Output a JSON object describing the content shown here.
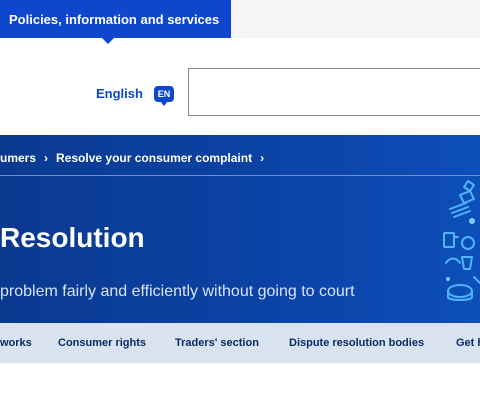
{
  "top_nav": {
    "tab_label": "Policies, information and services"
  },
  "language": {
    "label": "English",
    "code": "EN"
  },
  "search": {
    "placeholder": ""
  },
  "breadcrumb": {
    "items": [
      "umers",
      "Resolve your consumer complaint"
    ]
  },
  "hero": {
    "title": "Resolution",
    "subtitle": "problem fairly and efficiently without going to court"
  },
  "section_nav": {
    "items": [
      "works",
      "Consumer rights",
      "Traders' section",
      "Dispute resolution bodies",
      "Get h"
    ]
  },
  "colors": {
    "brand_blue": "#0e47cb",
    "hero_blue": "#0b43a8",
    "nav_bg": "#d8e3ef"
  }
}
